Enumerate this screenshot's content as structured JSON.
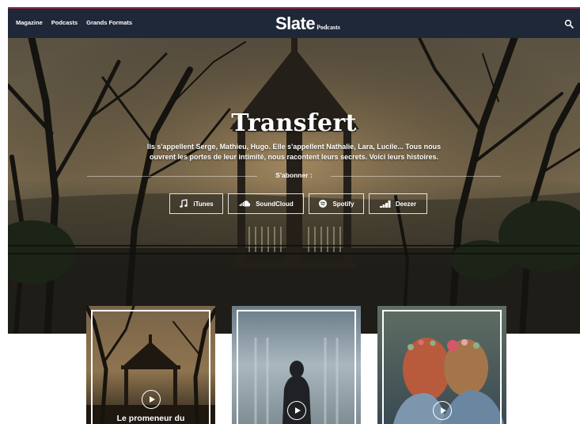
{
  "nav": {
    "links": [
      "Magazine",
      "Podcasts",
      "Grands Formats"
    ],
    "logo_main": "Slate",
    "logo_sub": "Podcasts",
    "search_icon": "search-icon"
  },
  "hero": {
    "title": "Transfert",
    "description_line1": "Ils s'appellent Serge, Mathieu, Hugo. Elle s'appellent Nathalie, Lara, Lucile... Tous nous",
    "description_line2": "ouvrent les portes de leur intimité, nous racontent leurs secrets. Voici leurs histoires.",
    "subscribe_label": "S'abonner :",
    "platforms": [
      {
        "label": "iTunes",
        "icon": "music-note-icon"
      },
      {
        "label": "SoundCloud",
        "icon": "soundcloud-icon"
      },
      {
        "label": "Spotify",
        "icon": "spotify-icon"
      },
      {
        "label": "Deezer",
        "icon": "deezer-icon"
      }
    ]
  },
  "cards": [
    {
      "title": "Le promeneur du",
      "icon": "play-icon"
    },
    {
      "title": "",
      "icon": "play-icon"
    },
    {
      "title": "",
      "icon": "play-icon"
    }
  ],
  "colors": {
    "navbar": "#1f2838",
    "accent": "#8a2b45",
    "text": "#ffffff"
  }
}
